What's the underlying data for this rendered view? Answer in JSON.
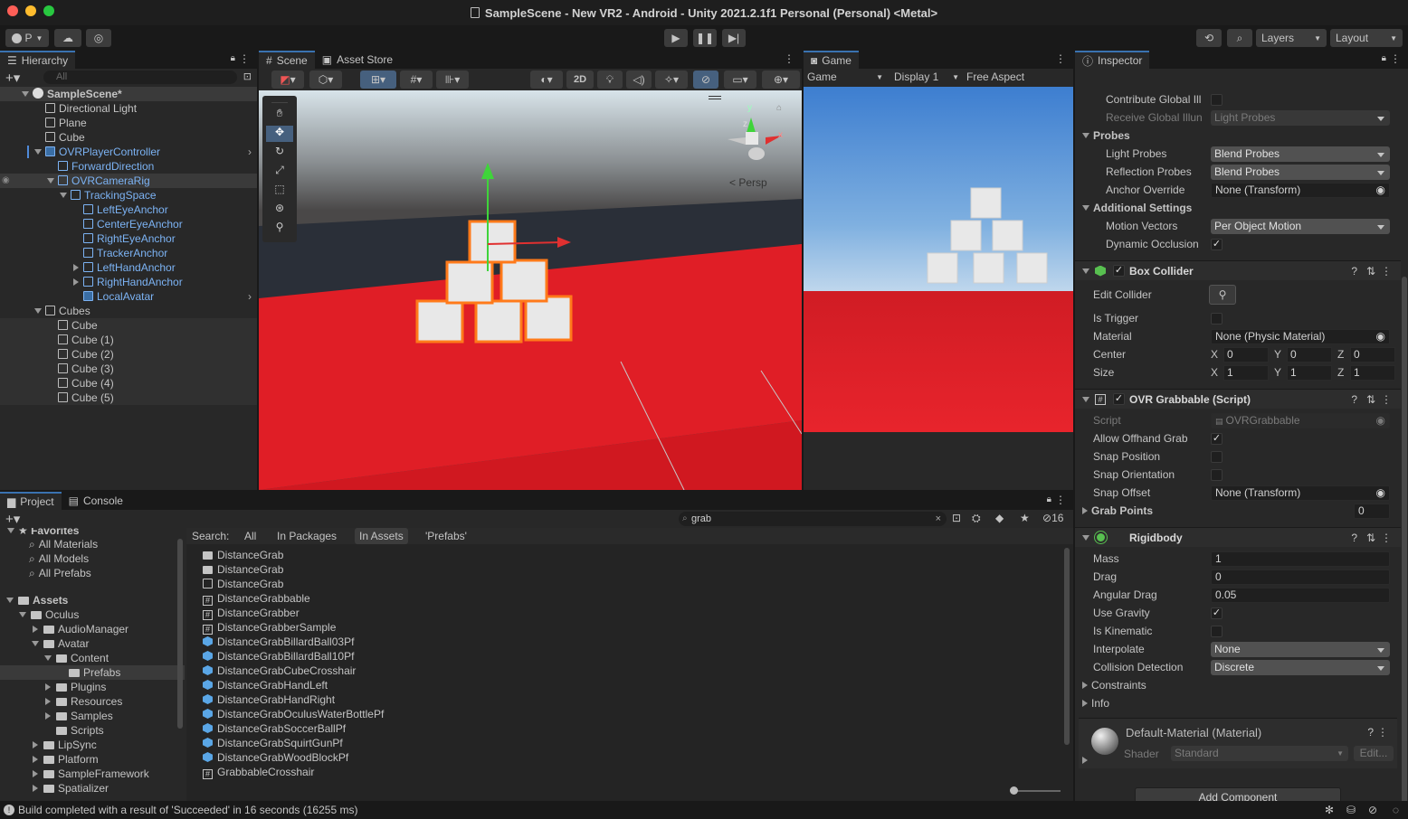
{
  "window": {
    "title": "SampleScene - New VR2 - Android - Unity 2021.2.1f1 Personal (Personal) <Metal>"
  },
  "toolbar": {
    "account": "P",
    "layers": "Layers",
    "layout": "Layout"
  },
  "hierarchy": {
    "tab": "Hierarchy",
    "search_placeholder": "All",
    "items": [
      {
        "label": "SampleScene*",
        "depth": 0,
        "type": "scene",
        "arrow": "open",
        "blue": false
      },
      {
        "label": "Directional Light",
        "depth": 1,
        "type": "obj",
        "arrow": "none",
        "blue": false
      },
      {
        "label": "Plane",
        "depth": 1,
        "type": "obj",
        "arrow": "none",
        "blue": false
      },
      {
        "label": "Cube",
        "depth": 1,
        "type": "obj",
        "arrow": "none",
        "blue": false
      },
      {
        "label": "OVRPlayerController",
        "depth": 1,
        "type": "prefab",
        "arrow": "open",
        "blue": true
      },
      {
        "label": "ForwardDirection",
        "depth": 2,
        "type": "obj",
        "arrow": "none",
        "blue": true
      },
      {
        "label": "OVRCameraRig",
        "depth": 2,
        "type": "obj",
        "arrow": "open",
        "blue": true
      },
      {
        "label": "TrackingSpace",
        "depth": 3,
        "type": "obj",
        "arrow": "open",
        "blue": true
      },
      {
        "label": "LeftEyeAnchor",
        "depth": 4,
        "type": "obj",
        "arrow": "none",
        "blue": true
      },
      {
        "label": "CenterEyeAnchor",
        "depth": 4,
        "type": "obj",
        "arrow": "none",
        "blue": true
      },
      {
        "label": "RightEyeAnchor",
        "depth": 4,
        "type": "obj",
        "arrow": "none",
        "blue": true
      },
      {
        "label": "TrackerAnchor",
        "depth": 4,
        "type": "obj",
        "arrow": "none",
        "blue": true
      },
      {
        "label": "LeftHandAnchor",
        "depth": 4,
        "type": "obj",
        "arrow": "closed",
        "blue": true
      },
      {
        "label": "RightHandAnchor",
        "depth": 4,
        "type": "obj",
        "arrow": "closed",
        "blue": true
      },
      {
        "label": "LocalAvatar",
        "depth": 4,
        "type": "prefab",
        "arrow": "none",
        "blue": true
      },
      {
        "label": "Cubes",
        "depth": 1,
        "type": "obj",
        "arrow": "open",
        "blue": false
      },
      {
        "label": "Cube",
        "depth": 2,
        "type": "obj",
        "arrow": "none",
        "blue": false
      },
      {
        "label": "Cube (1)",
        "depth": 2,
        "type": "obj",
        "arrow": "none",
        "blue": false
      },
      {
        "label": "Cube (2)",
        "depth": 2,
        "type": "obj",
        "arrow": "none",
        "blue": false
      },
      {
        "label": "Cube (3)",
        "depth": 2,
        "type": "obj",
        "arrow": "none",
        "blue": false
      },
      {
        "label": "Cube (4)",
        "depth": 2,
        "type": "obj",
        "arrow": "none",
        "blue": false
      },
      {
        "label": "Cube (5)",
        "depth": 2,
        "type": "obj",
        "arrow": "none",
        "blue": false
      }
    ]
  },
  "scene": {
    "tab_scene": "Scene",
    "tab_store": "Asset Store",
    "btn_2d": "2D",
    "persp": "Persp",
    "gizmo_y": "y",
    "gizmo_x": "x",
    "gizmo_z": "z"
  },
  "game": {
    "tab": "Game",
    "mode": "Game",
    "display": "Display 1",
    "aspect": "Free Aspect"
  },
  "inspector": {
    "tab": "Inspector",
    "top_rows": [
      {
        "label": "Contribute Global Ill",
        "kind": "check",
        "value": ""
      },
      {
        "label": "Receive Global Illun",
        "kind": "dropdim",
        "value": "Light Probes"
      }
    ],
    "probes_header": "Probes",
    "probes": [
      {
        "label": "Light Probes",
        "value": "Blend Probes",
        "kind": "drop"
      },
      {
        "label": "Reflection Probes",
        "value": "Blend Probes",
        "kind": "drop"
      },
      {
        "label": "Anchor Override",
        "value": "None (Transform)",
        "kind": "field"
      }
    ],
    "additional_header": "Additional Settings",
    "additional": [
      {
        "label": "Motion Vectors",
        "value": "Per Object Motion",
        "kind": "drop"
      },
      {
        "label": "Dynamic Occlusion",
        "value": "✓",
        "kind": "check"
      }
    ],
    "box_collider": {
      "title": "Box Collider",
      "edit_collider": "Edit Collider",
      "is_trigger": "Is Trigger",
      "material_label": "Material",
      "material": "None (Physic Material)",
      "center_label": "Center",
      "size_label": "Size",
      "center": {
        "x": "0",
        "y": "0",
        "z": "0"
      },
      "size": {
        "x": "1",
        "y": "1",
        "z": "1"
      }
    },
    "grabbable": {
      "title": "OVR Grabbable (Script)",
      "script_label": "Script",
      "script": "OVRGrabbable",
      "allow_offhand": "Allow Offhand Grab",
      "snap_position": "Snap Position",
      "snap_orientation": "Snap Orientation",
      "snap_offset": "Snap Offset",
      "snap_offset_value": "None (Transform)",
      "grab_points": "Grab Points",
      "grab_points_value": "0"
    },
    "rigidbody": {
      "title": "Rigidbody",
      "mass_label": "Mass",
      "mass": "1",
      "drag_label": "Drag",
      "drag": "0",
      "angular_label": "Angular Drag",
      "angular": "0.05",
      "gravity_label": "Use Gravity",
      "kinematic_label": "Is Kinematic",
      "interpolate_label": "Interpolate",
      "interpolate": "None",
      "collision_label": "Collision Detection",
      "collision": "Discrete",
      "constraints": "Constraints",
      "info": "Info"
    },
    "material": {
      "title": "Default-Material (Material)",
      "shader_label": "Shader",
      "shader": "Standard",
      "edit": "Edit..."
    },
    "add_component": "Add Component"
  },
  "project": {
    "tab_project": "Project",
    "tab_console": "Console",
    "search_value": "grab",
    "hidden_count": "16",
    "favorites_header": "Favorites",
    "favorites": [
      "All Materials",
      "All Models",
      "All Prefabs"
    ],
    "tree": [
      {
        "label": "Assets",
        "depth": 0,
        "arrow": "open",
        "bold": true,
        "selected": false
      },
      {
        "label": "Oculus",
        "depth": 1,
        "arrow": "open",
        "bold": false,
        "selected": false
      },
      {
        "label": "AudioManager",
        "depth": 2,
        "arrow": "closed",
        "bold": false,
        "selected": false
      },
      {
        "label": "Avatar",
        "depth": 2,
        "arrow": "open",
        "bold": false,
        "selected": false
      },
      {
        "label": "Content",
        "depth": 3,
        "arrow": "open",
        "bold": false,
        "selected": false
      },
      {
        "label": "Prefabs",
        "depth": 4,
        "arrow": "none",
        "bold": false,
        "selected": true
      },
      {
        "label": "Plugins",
        "depth": 3,
        "arrow": "closed",
        "bold": false,
        "selected": false
      },
      {
        "label": "Resources",
        "depth": 3,
        "arrow": "closed",
        "bold": false,
        "selected": false
      },
      {
        "label": "Samples",
        "depth": 3,
        "arrow": "closed",
        "bold": false,
        "selected": false
      },
      {
        "label": "Scripts",
        "depth": 3,
        "arrow": "none",
        "bold": false,
        "selected": false
      },
      {
        "label": "LipSync",
        "depth": 2,
        "arrow": "closed",
        "bold": false,
        "selected": false
      },
      {
        "label": "Platform",
        "depth": 2,
        "arrow": "closed",
        "bold": false,
        "selected": false
      },
      {
        "label": "SampleFramework",
        "depth": 2,
        "arrow": "closed",
        "bold": false,
        "selected": false
      },
      {
        "label": "Spatializer",
        "depth": 2,
        "arrow": "closed",
        "bold": false,
        "selected": false
      }
    ],
    "search_label": "Search:",
    "filters": [
      "All",
      "In Packages",
      "In Assets",
      "'Prefabs'"
    ],
    "files": [
      {
        "name": "DistanceGrab",
        "type": "folder"
      },
      {
        "name": "DistanceGrab",
        "type": "folder"
      },
      {
        "name": "DistanceGrab",
        "type": "scene"
      },
      {
        "name": "DistanceGrabbable",
        "type": "script"
      },
      {
        "name": "DistanceGrabber",
        "type": "script"
      },
      {
        "name": "DistanceGrabberSample",
        "type": "script"
      },
      {
        "name": "DistanceGrabBillardBall03Pf",
        "type": "prefab"
      },
      {
        "name": "DistanceGrabBillardBall10Pf",
        "type": "prefab"
      },
      {
        "name": "DistanceGrabCubeCrosshair",
        "type": "prefab"
      },
      {
        "name": "DistanceGrabHandLeft",
        "type": "prefab"
      },
      {
        "name": "DistanceGrabHandRight",
        "type": "prefab"
      },
      {
        "name": "DistanceGrabOculusWaterBottlePf",
        "type": "prefab"
      },
      {
        "name": "DistanceGrabSoccerBallPf",
        "type": "prefab"
      },
      {
        "name": "DistanceGrabSquirtGunPf",
        "type": "prefab"
      },
      {
        "name": "DistanceGrabWoodBlockPf",
        "type": "prefab"
      },
      {
        "name": "GrabbableCrosshair",
        "type": "script"
      }
    ]
  },
  "status": {
    "message": "Build completed with a result of 'Succeeded' in 16 seconds (16255 ms)"
  }
}
